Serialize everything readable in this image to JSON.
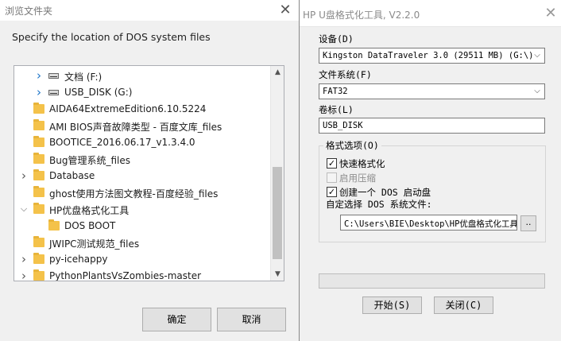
{
  "browse_dialog": {
    "title": "浏览文件夹",
    "prompt": "Specify the location of DOS system files",
    "ok_label": "确定",
    "cancel_label": "取消",
    "tree_items": [
      {
        "label": "文档 (F:)",
        "icon": "drive-icon",
        "expanded": false
      },
      {
        "label": "USB_DISK (G:)",
        "icon": "drive-icon",
        "expanded": false
      },
      {
        "label": "AIDA64ExtremeEdition6.10.5224",
        "icon": "folder-icon",
        "expanded": null
      },
      {
        "label": "AMI BIOS声音故障类型 - 百度文库_files",
        "icon": "folder-icon",
        "expanded": null
      },
      {
        "label": "BOOTICE_2016.06.17_v1.3.4.0",
        "icon": "folder-icon",
        "expanded": null
      },
      {
        "label": "Bug管理系统_files",
        "icon": "folder-icon",
        "expanded": null
      },
      {
        "label": "Database",
        "icon": "folder-icon",
        "expanded": false
      },
      {
        "label": "ghost使用方法图文教程-百度经验_files",
        "icon": "folder-icon",
        "expanded": null
      },
      {
        "label": "HP优盘格式化工具",
        "icon": "folder-icon",
        "expanded": true
      },
      {
        "label": "DOS BOOT",
        "icon": "folder-icon",
        "expanded": null
      },
      {
        "label": "JWIPC测试规范_files",
        "icon": "folder-icon",
        "expanded": null
      },
      {
        "label": "py-icehappy",
        "icon": "folder-icon",
        "expanded": false
      },
      {
        "label": "PythonPlantsVsZombies-master",
        "icon": "folder-icon",
        "expanded": false
      }
    ]
  },
  "hp_tool": {
    "title": "HP U盘格式化工具, V2.2.0",
    "device_label": "设备(D)",
    "device_value": "Kingston DataTraveler 3.0  (29511 MB) (G:\\)",
    "filesystem_label": "文件系统(F)",
    "filesystem_value": "FAT32",
    "volume_label": "卷标(L)",
    "volume_value": "USB_DISK",
    "format_options_label": "格式选项(O)",
    "quick_format_label": "快速格式化",
    "quick_format_checked": true,
    "enable_compression_label": "启用压缩",
    "enable_compression_checked": false,
    "create_dos_label": "创建一个 DOS 启动盘",
    "create_dos_checked": true,
    "dos_files_label": "自定选择 DOS 系统文件:",
    "dos_files_path": "C:\\Users\\BIE\\Desktop\\HP优盘格式化工具",
    "browse_label": "..",
    "progress": 0,
    "start_label": "开始(S)",
    "close_label": "关闭(C)"
  }
}
